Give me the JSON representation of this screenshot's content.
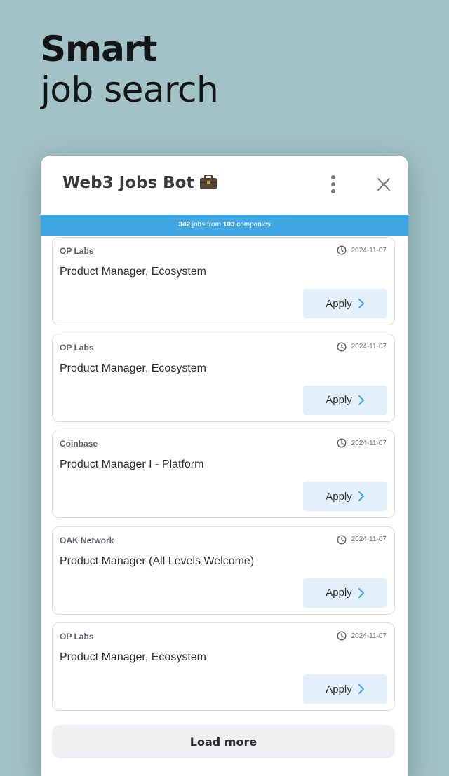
{
  "headline": {
    "bold": "Smart",
    "light": "job search"
  },
  "window": {
    "title": "Web3 Jobs Bot",
    "title_emoji_icon": "briefcase-icon",
    "menu_icon": "kebab-menu-icon",
    "close_icon": "close-icon"
  },
  "banner": {
    "jobs_count": "342",
    "jobs_text": " jobs from ",
    "companies_count": "103",
    "companies_text": " companies"
  },
  "jobs": [
    {
      "company": "OP Labs",
      "date": "2024-11-07",
      "title": "Product Manager, Ecosystem",
      "apply_label": "Apply"
    },
    {
      "company": "OP Labs",
      "date": "2024-11-07",
      "title": "Product Manager, Ecosystem",
      "apply_label": "Apply"
    },
    {
      "company": "Coinbase",
      "date": "2024-11-07",
      "title": "Product Manager I - Platform",
      "apply_label": "Apply"
    },
    {
      "company": "OAK Network",
      "date": "2024-11-07",
      "title": "Product Manager (All Levels Welcome)",
      "apply_label": "Apply"
    },
    {
      "company": "OP Labs",
      "date": "2024-11-07",
      "title": "Product Manager, Ecosystem",
      "apply_label": "Apply"
    }
  ],
  "load_more_label": "Load more",
  "colors": {
    "background": "#a2c3c6",
    "banner": "#3fa8e4",
    "apply_bg": "#e3f0fa",
    "accent": "#3fa8e4"
  }
}
